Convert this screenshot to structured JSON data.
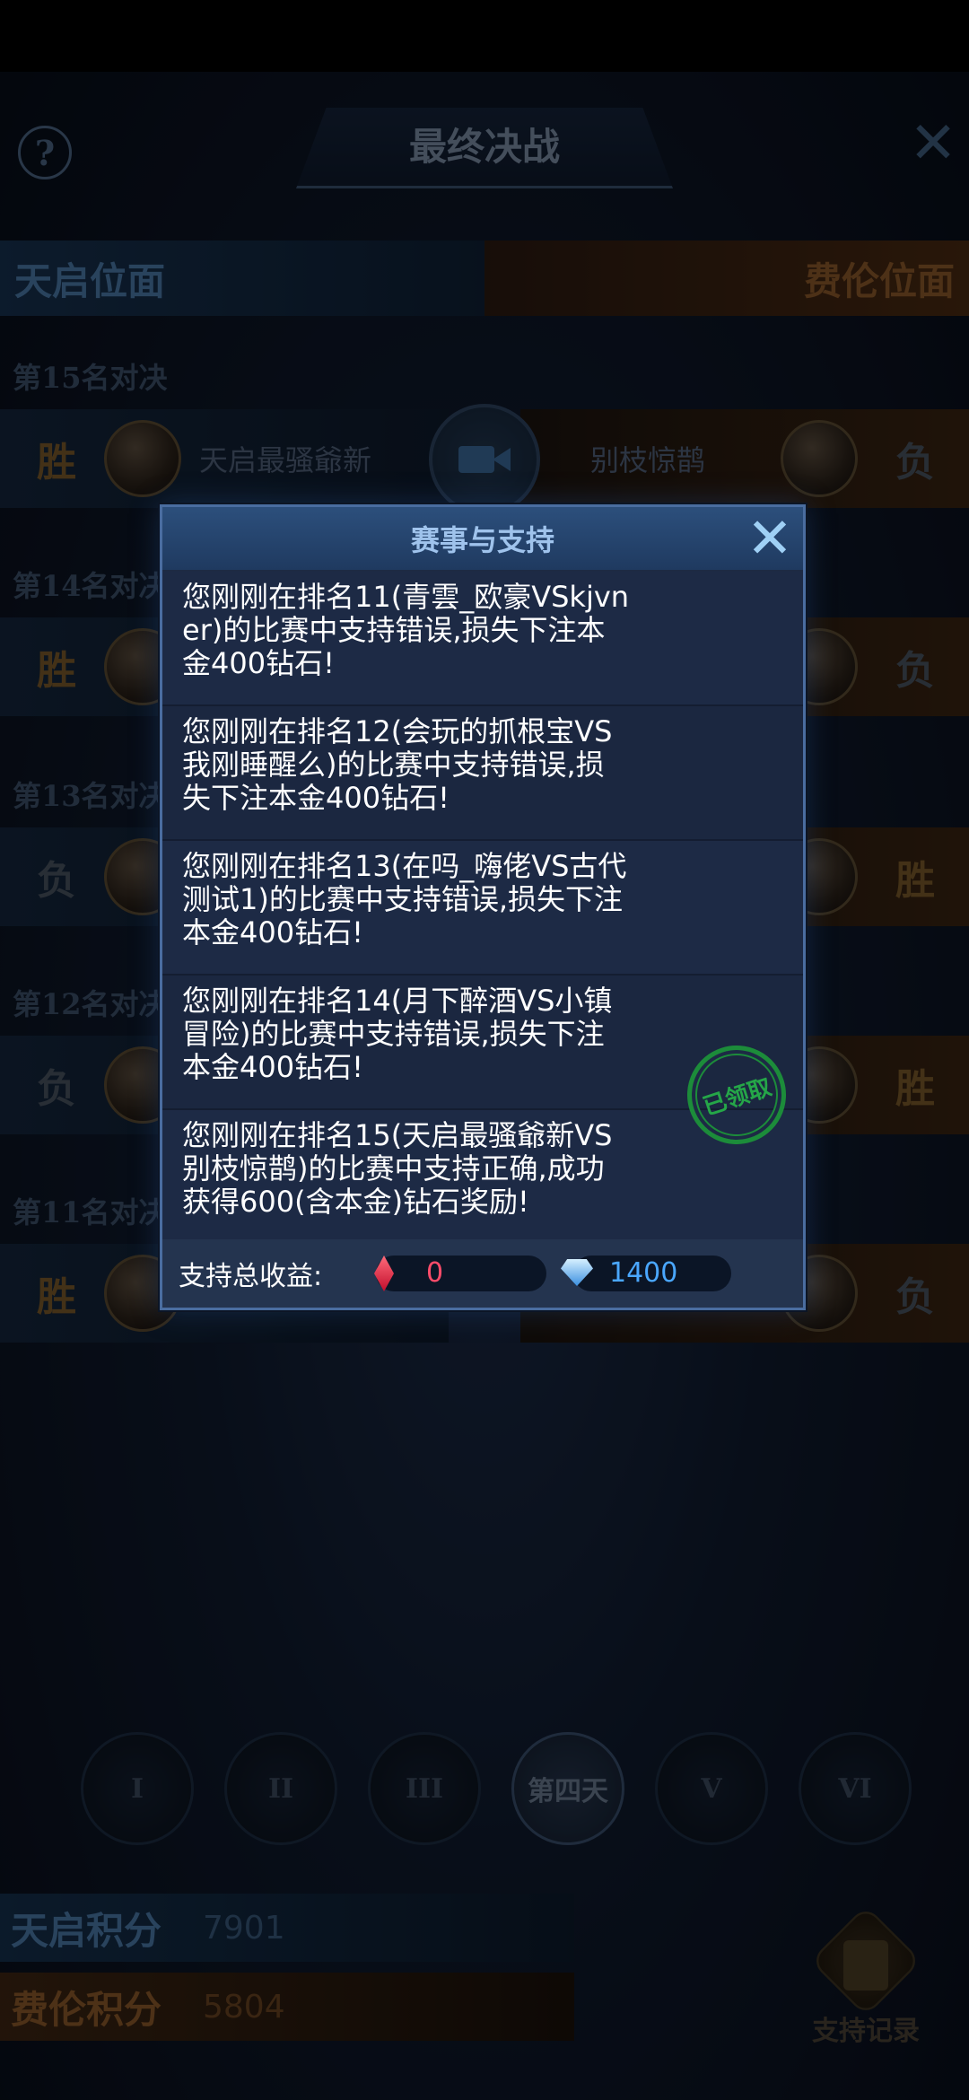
{
  "header": {
    "title": "最终决战",
    "help_symbol": "?",
    "close_symbol": "✕"
  },
  "sides": {
    "left": "天启位面",
    "right": "费伦位面"
  },
  "matches": [
    {
      "label": "第15名对决",
      "left_result": "胜",
      "left_name": "天启最骚爺新",
      "right_name": "别枝惊鹊",
      "right_result": "负"
    },
    {
      "label": "第14名对决",
      "left_result": "胜",
      "right_result": "负"
    },
    {
      "label": "第13名对决",
      "left_result": "负",
      "right_result": "胜"
    },
    {
      "label": "第12名对决",
      "left_result": "负",
      "right_result": "胜"
    },
    {
      "label": "第11名对决",
      "left_result": "胜",
      "right_result": "负"
    }
  ],
  "days": [
    "I",
    "II",
    "III",
    "第四天",
    "V",
    "VI"
  ],
  "scores": [
    {
      "name": "天启积分",
      "value": "7901"
    },
    {
      "name": "费伦积分",
      "value": "5804"
    }
  ],
  "support_records_label": "支持记录",
  "modal": {
    "title": "赛事与支持",
    "close_symbol": "✕",
    "messages": [
      "您刚刚在排名11(青雲_欧豪VSkjvner)的比赛中支持错误,损失下注本金400钻石!",
      "您刚刚在排名12(会玩的抓根宝VS我刚睡醒么)的比赛中支持错误,损失下注本金400钻石!",
      "您刚刚在排名13(在吗_嗨佬VS古代测试1)的比赛中支持错误,损失下注本金400钻石!",
      "您刚刚在排名14(月下醉酒VS小镇冒险)的比赛中支持错误,损失下注本金400钻石!",
      "您刚刚在排名15(天启最骚爺新VS别枝惊鹊)的比赛中支持正确,成功获得600(含本金)钻石奖励!"
    ],
    "claimed_stamp": "已领取",
    "footer_label": "支持总收益:",
    "ruby_value": "0",
    "diamond_value": "1400",
    "colors": {
      "ruby": "#ff4c6a",
      "diamond": "#4aa7ff",
      "stamp": "#25a648"
    }
  }
}
